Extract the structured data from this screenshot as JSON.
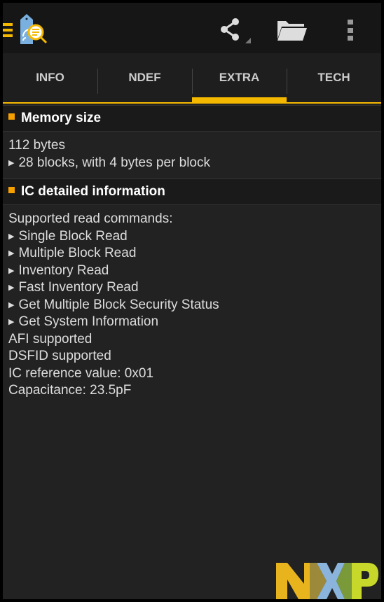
{
  "tabs": [
    {
      "label": "INFO"
    },
    {
      "label": "NDEF"
    },
    {
      "label": "EXTRA",
      "active": true
    },
    {
      "label": "TECH"
    }
  ],
  "sections": [
    {
      "title": "Memory size",
      "lines": [
        {
          "text": "112 bytes",
          "bullet": false
        },
        {
          "text": "28 blocks, with 4 bytes per block",
          "bullet": true
        }
      ]
    },
    {
      "title": "IC detailed information",
      "lines": [
        {
          "text": "Supported read commands:",
          "bullet": false
        },
        {
          "text": "Single Block Read",
          "bullet": true
        },
        {
          "text": "Multiple Block Read",
          "bullet": true
        },
        {
          "text": "Inventory Read",
          "bullet": true
        },
        {
          "text": "Fast Inventory Read",
          "bullet": true
        },
        {
          "text": "Get Multiple Block Security Status",
          "bullet": true
        },
        {
          "text": "Get System Information",
          "bullet": true
        },
        {
          "text": "AFI supported",
          "bullet": false
        },
        {
          "text": "DSFID supported",
          "bullet": false
        },
        {
          "text": "IC reference value: 0x01",
          "bullet": false
        },
        {
          "text": "Capacitance: 23.5pF",
          "bullet": false
        }
      ]
    }
  ],
  "logo": {
    "text": "NXP"
  },
  "colors": {
    "accent": "#f5b800",
    "background": "#222222"
  }
}
